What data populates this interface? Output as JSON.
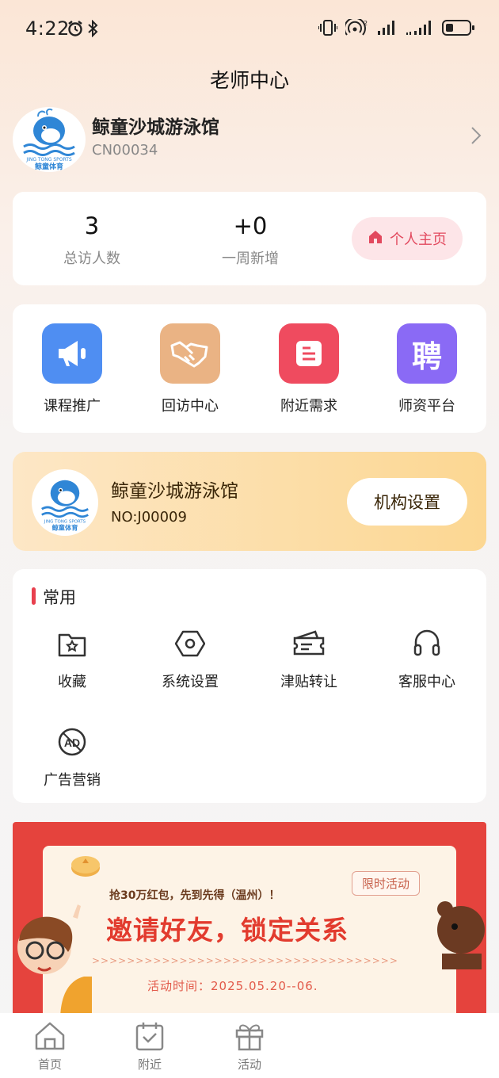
{
  "status_bar": {
    "time": "4:22"
  },
  "header": {
    "title": "老师中心"
  },
  "profile": {
    "name": "鲸童沙城游泳馆",
    "code": "CN00034"
  },
  "stats": {
    "visitors_value": "3",
    "visitors_label": "总访人数",
    "weekly_value": "+0",
    "weekly_label": "一周新增",
    "homepage_button": "个人主页"
  },
  "features": [
    {
      "label": "课程推广",
      "icon": "megaphone-icon",
      "color": "#4f8ef2"
    },
    {
      "label": "回访中心",
      "icon": "handshake-icon",
      "color": "#eab384"
    },
    {
      "label": "附近需求",
      "icon": "document-icon",
      "color": "#ef4b5f"
    },
    {
      "label": "师资平台",
      "icon": "recruit-icon",
      "color": "#8a6af5",
      "glyph": "聘"
    }
  ],
  "organization": {
    "name": "鲸童沙城游泳馆",
    "no": "NO:J00009",
    "settings_button": "机构设置"
  },
  "common": {
    "title": "常用",
    "items": [
      {
        "label": "收藏",
        "icon": "favorite-folder-icon"
      },
      {
        "label": "系统设置",
        "icon": "settings-hexagon-icon"
      },
      {
        "label": "津贴转让",
        "icon": "ticket-transfer-icon"
      },
      {
        "label": "客服中心",
        "icon": "headset-icon"
      },
      {
        "label": "广告营销",
        "icon": "ad-icon"
      }
    ]
  },
  "banner": {
    "subtitle": "抢30万红包，先到先得（温州）！",
    "headline": "邀请好友，锁定关系",
    "arrows": ">>>>>>>>>>>>>>>>>>>>>>>>>>>>>>>>>>>",
    "date": "活动时间：2025.05.20--06.",
    "tag": "限时活动"
  },
  "logo_text": {
    "en": "JING TONG SPORTS",
    "zh": "鲸童体育"
  },
  "tabbar": [
    {
      "label": "首页",
      "icon": "home-icon"
    },
    {
      "label": "附近",
      "icon": "nearby-check-icon"
    },
    {
      "label": "活动",
      "icon": "gift-icon"
    }
  ],
  "colors": {
    "accent_red": "#e8404e",
    "org_card_start": "#fde7c6",
    "org_card_end": "#fcd792"
  }
}
